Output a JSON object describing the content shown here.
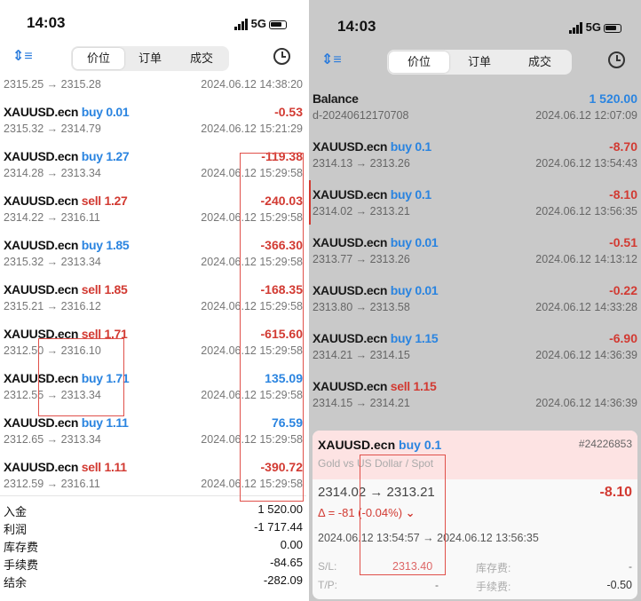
{
  "left": {
    "status": {
      "time": "14:03",
      "network": "5G"
    },
    "tabs": [
      "价位",
      "订单",
      "成交"
    ],
    "active_tab": 0,
    "first_row": {
      "prices": "2315.25 → 2315.28",
      "datetime": "2024.06.12 14:38:20"
    },
    "rows": [
      {
        "symbol": "XAUUSD.ecn",
        "side": "buy",
        "volume": "0.01",
        "profit": "-0.53",
        "prices": "2315.32 → 2314.79",
        "datetime": "2024.06.12 15:21:29"
      },
      {
        "symbol": "XAUUSD.ecn",
        "side": "buy",
        "volume": "1.27",
        "profit": "-119.38",
        "prices": "2314.28 → 2313.34",
        "datetime": "2024.06.12 15:29:58"
      },
      {
        "symbol": "XAUUSD.ecn",
        "side": "sell",
        "volume": "1.27",
        "profit": "-240.03",
        "prices": "2314.22 → 2316.11",
        "datetime": "2024.06.12 15:29:58"
      },
      {
        "symbol": "XAUUSD.ecn",
        "side": "buy",
        "volume": "1.85",
        "profit": "-366.30",
        "prices": "2315.32 → 2313.34",
        "datetime": "2024.06.12 15:29:58"
      },
      {
        "symbol": "XAUUSD.ecn",
        "side": "sell",
        "volume": "1.85",
        "profit": "-168.35",
        "prices": "2315.21 → 2316.12",
        "datetime": "2024.06.12 15:29:58"
      },
      {
        "symbol": "XAUUSD.ecn",
        "side": "sell",
        "volume": "1.71",
        "profit": "-615.60",
        "prices": "2312.50 → 2316.10",
        "datetime": "2024.06.12 15:29:58"
      },
      {
        "symbol": "XAUUSD.ecn",
        "side": "buy",
        "volume": "1.71",
        "profit": "135.09",
        "prices": "2312.55 → 2313.34",
        "datetime": "2024.06.12 15:29:58"
      },
      {
        "symbol": "XAUUSD.ecn",
        "side": "buy",
        "volume": "1.11",
        "profit": "76.59",
        "prices": "2312.65 → 2313.34",
        "datetime": "2024.06.12 15:29:58"
      },
      {
        "symbol": "XAUUSD.ecn",
        "side": "sell",
        "volume": "1.11",
        "profit": "-390.72",
        "prices": "2312.59 → 2316.11",
        "datetime": "2024.06.12 15:29:58"
      }
    ],
    "summary": [
      {
        "label": "入金",
        "value": "1 520.00"
      },
      {
        "label": "利润",
        "value": "-1 717.44"
      },
      {
        "label": "库存费",
        "value": "0.00"
      },
      {
        "label": "手续费",
        "value": "-84.65"
      },
      {
        "label": "结余",
        "value": "-282.09"
      }
    ]
  },
  "right": {
    "status": {
      "time": "14:03",
      "network": "5G"
    },
    "tabs": [
      "价位",
      "订单",
      "成交"
    ],
    "active_tab": 0,
    "balance": {
      "label": "Balance",
      "value": "1 520.00",
      "id": "d-20240612170708",
      "datetime": "2024.06.12 12:07:09"
    },
    "rows": [
      {
        "symbol": "XAUUSD.ecn",
        "side": "buy",
        "volume": "0.1",
        "profit": "-8.70",
        "prices": "2314.13 → 2313.26",
        "datetime": "2024.06.12 13:54:43"
      },
      {
        "symbol": "XAUUSD.ecn",
        "side": "buy",
        "volume": "0.1",
        "profit": "-8.10",
        "prices": "2314.02 → 2313.21",
        "datetime": "2024.06.12 13:56:35"
      },
      {
        "symbol": "XAUUSD.ecn",
        "side": "buy",
        "volume": "0.01",
        "profit": "-0.51",
        "prices": "2313.77 → 2313.26",
        "datetime": "2024.06.12 14:13:12"
      },
      {
        "symbol": "XAUUSD.ecn",
        "side": "buy",
        "volume": "0.01",
        "profit": "-0.22",
        "prices": "2313.80 → 2313.58",
        "datetime": "2024.06.12 14:33:28"
      },
      {
        "symbol": "XAUUSD.ecn",
        "side": "buy",
        "volume": "1.15",
        "profit": "-6.90",
        "prices": "2314.21 → 2314.15",
        "datetime": "2024.06.12 14:36:39"
      },
      {
        "symbol": "XAUUSD.ecn",
        "side": "sell",
        "volume": "1.15",
        "profit": "",
        "prices": "2314.15 → 2314.21",
        "datetime": "2024.06.12 14:36:39"
      }
    ],
    "detail": {
      "symbol": "XAUUSD.ecn",
      "side": "buy",
      "volume": "0.1",
      "ticket": "#24226853",
      "description": "Gold vs US Dollar / Spot",
      "prices": "2314.02 → 2313.21",
      "profit": "-8.10",
      "delta": "Δ = -81 (-0.04%)",
      "times": "2024.06.12 13:54:57 → 2024.06.12 13:56:35",
      "sl_label": "S/L:",
      "sl": "2313.40",
      "tp_label": "T/P:",
      "tp": "-",
      "swap_label": "库存费:",
      "swap": "-",
      "commission_label": "手续费:",
      "commission": "-0.50"
    }
  },
  "colors": {
    "buy": "#2a84e0",
    "sell": "#d23a32",
    "highlight": "#e0504a"
  }
}
